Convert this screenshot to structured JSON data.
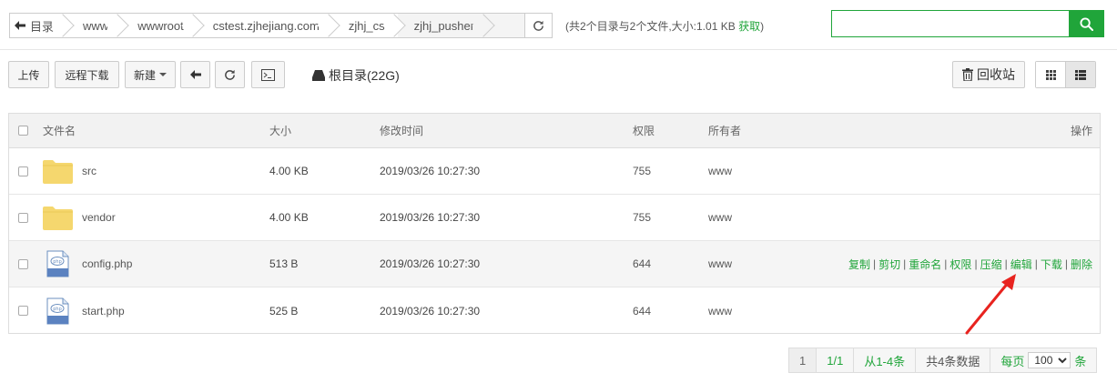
{
  "path": {
    "crumbs": [
      "目录",
      "www",
      "wwwroot",
      "cstest.zjhejiang.com",
      "zjhj_cs",
      "zjhj_pusher"
    ]
  },
  "dirinfo": {
    "text": "(共2个目录与2个文件,大小:1.01 KB",
    "get": "获取",
    "close": ")"
  },
  "search": {
    "value": "",
    "placeholder": ""
  },
  "toolbar": {
    "upload": "上传",
    "remote_download": "远程下载",
    "new": "新建",
    "root_dir": "根目录(22G)",
    "recycle": "回收站"
  },
  "table": {
    "headers": {
      "name": "文件名",
      "size": "大小",
      "mtime": "修改时间",
      "perm": "权限",
      "owner": "所有者",
      "ops": "操作"
    },
    "rows": [
      {
        "type": "folder",
        "name": "src",
        "size": "4.00 KB",
        "mtime": "2019/03/26 10:27:30",
        "perm": "755",
        "owner": "www"
      },
      {
        "type": "folder",
        "name": "vendor",
        "size": "4.00 KB",
        "mtime": "2019/03/26 10:27:30",
        "perm": "755",
        "owner": "www"
      },
      {
        "type": "php",
        "name": "config.php",
        "size": "513 B",
        "mtime": "2019/03/26 10:27:30",
        "perm": "644",
        "owner": "www"
      },
      {
        "type": "php",
        "name": "start.php",
        "size": "525 B",
        "mtime": "2019/03/26 10:27:30",
        "perm": "644",
        "owner": "www"
      }
    ],
    "ops": [
      "复制",
      "剪切",
      "重命名",
      "权限",
      "压缩",
      "编辑",
      "下载",
      "删除"
    ],
    "php_badge": "PHP"
  },
  "pager": {
    "current": "1",
    "pages": "1/1",
    "range": "从1-4条",
    "total": "共4条数据",
    "per_page_label": "每页",
    "per_page_value": "100",
    "unit": "条"
  },
  "colors": {
    "accent": "#20a53a",
    "arrow": "#e8231f",
    "folder": "#f5d76e"
  }
}
